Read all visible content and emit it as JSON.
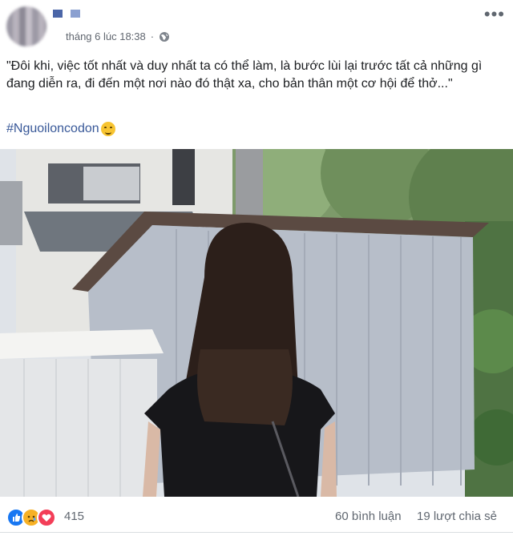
{
  "post": {
    "timestamp": "tháng 6 lúc 18:38",
    "text": "\"Đôi khi, việc tốt nhất và duy nhất ta có thể làm, là bước lùi lại trước tất cả những gì đang diễn ra, đi đến một nơi nào đó thật xa, cho bản thân một cơ hội để thở...\"",
    "hashtag": "#Nguoiloncodon",
    "hashtag_emoji": "smiling-face-icon"
  },
  "icons": {
    "privacy": "globe-icon",
    "more": "more-options-icon",
    "reactions": [
      "like-icon",
      "sad-icon",
      "love-icon"
    ]
  },
  "engagement": {
    "reaction_count": "415",
    "comments": "60 bình luận",
    "shares": "19 lượt chia sẻ"
  },
  "colors": {
    "link": "#385898",
    "meta_text": "#616770",
    "like": "#1877f2",
    "sad": "#f7b125",
    "love": "#f33e58"
  }
}
